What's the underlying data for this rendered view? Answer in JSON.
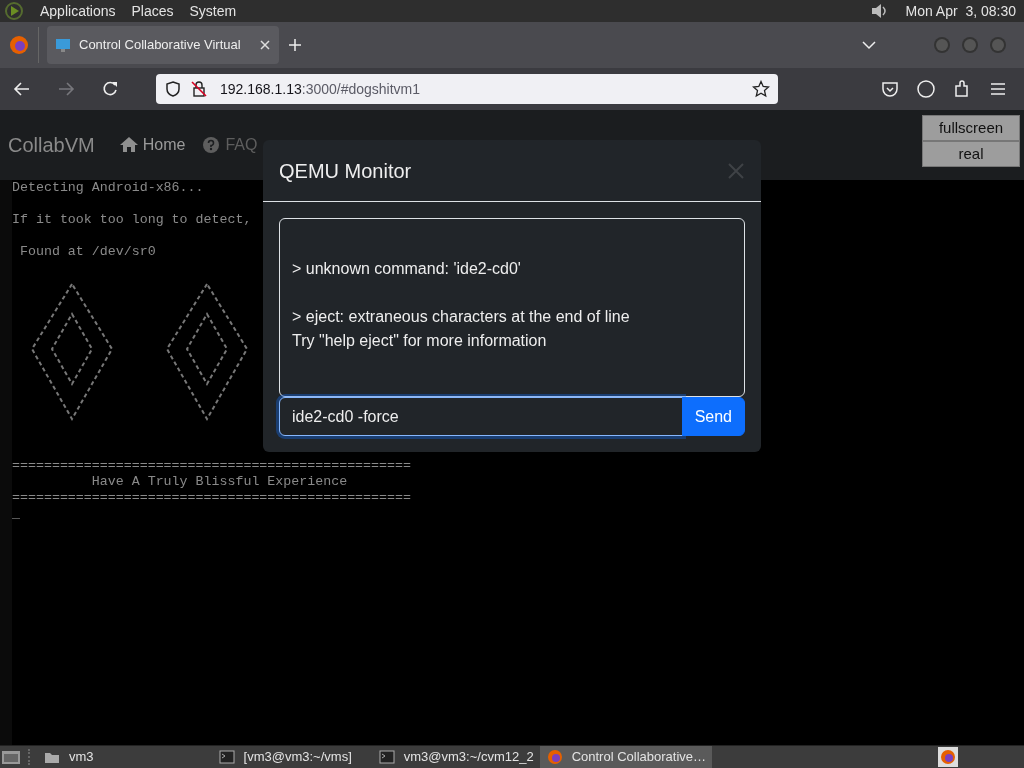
{
  "top_panel": {
    "menus": [
      "Applications",
      "Places",
      "System"
    ],
    "clock": "Mon Apr  3, 08:30"
  },
  "browser": {
    "tabs": [
      {
        "title": "Control Collaborative Virtual",
        "selected": true
      }
    ],
    "nav_buttons": [
      {
        "kind": "back",
        "disabled": false
      },
      {
        "kind": "forward",
        "disabled": true
      },
      {
        "kind": "reload",
        "disabled": false
      }
    ],
    "url": {
      "host": "192.168.1.13",
      "rest": ":3000/#dogshitvm1"
    }
  },
  "site": {
    "brand": "CollabVM",
    "nav_items": [
      {
        "kind": "home",
        "label": "Home"
      },
      {
        "kind": "faq",
        "label": "FAQ"
      }
    ],
    "view_buttons": [
      "fullscreen",
      "real"
    ]
  },
  "console": {
    "lines": [
      {
        "kind": "message",
        "text": "Detecting Android-x86..."
      },
      {
        "kind": "message",
        "text": "If it took too long to detect,"
      },
      {
        "kind": "message",
        "text": " Found at /dev/sr0"
      },
      {
        "kind": "art"
      },
      {
        "kind": "rule",
        "text": "=================================================="
      },
      {
        "kind": "banner",
        "text": "          Have A Truly Blissful Experience"
      },
      {
        "kind": "rule",
        "text": "=================================================="
      },
      {
        "kind": "cursor",
        "text": "_"
      }
    ]
  },
  "modal": {
    "title": "QEMU Monitor",
    "output": [
      {
        "kind": "error",
        "text": "> unknown command: 'ide2-cd0'"
      },
      {
        "kind": "error",
        "text": "> eject: extraneous characters at the end of line"
      },
      {
        "kind": "detail",
        "text": "Try \"help eject\" for more information"
      }
    ],
    "input": {
      "value": "ide2-cd0 -force"
    },
    "send_label": "Send"
  },
  "taskbar": {
    "items": [
      {
        "kind": "folder",
        "label": "vm3",
        "selected": false
      },
      {
        "kind": "terminal",
        "label": "[vm3@vm3:~/vms]",
        "selected": false
      },
      {
        "kind": "terminal",
        "label": "vm3@vm3:~/cvm12_2",
        "selected": false
      },
      {
        "kind": "browser",
        "label": "Control Collaborative…",
        "selected": true
      }
    ]
  }
}
